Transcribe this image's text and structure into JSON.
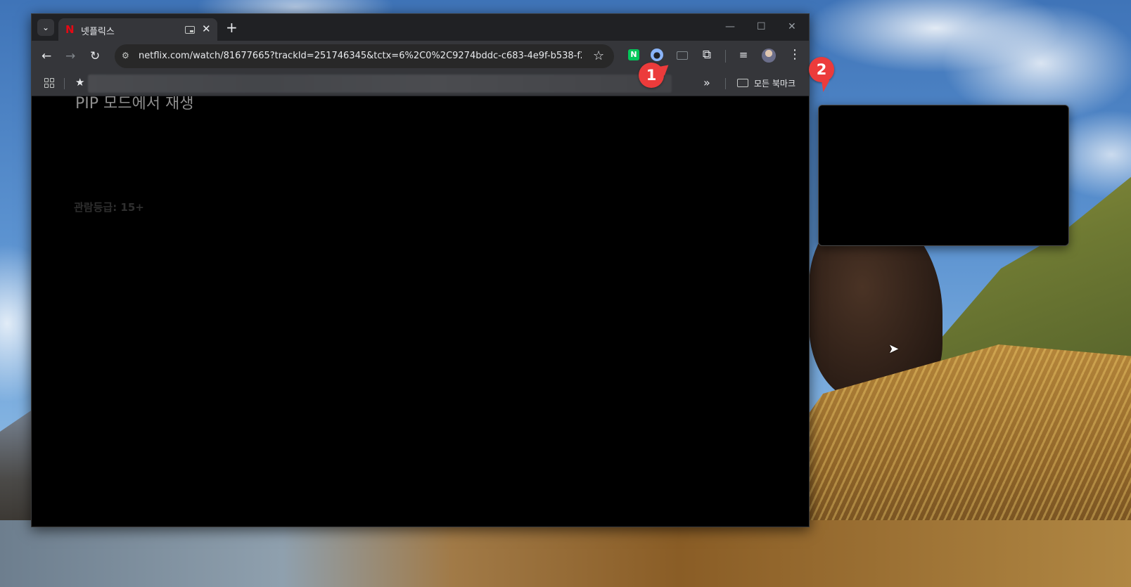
{
  "tab": {
    "title": "넷플릭스",
    "favicon": "netflix-icon"
  },
  "omnibox": {
    "url": "netflix.com/watch/81677665?trackId=251746345&tctx=6%2C0%2C9274bddc-c683-4e9f-b538-f28de..."
  },
  "extensions": {
    "naver_label": "N"
  },
  "bookmarks_bar": {
    "all_bookmarks_label": "모든 북마크"
  },
  "video": {
    "heading": "PIP 모드에서 재생",
    "rating": "관람등급: 15+"
  },
  "annotations": {
    "marker_1": "1",
    "marker_2": "2"
  },
  "colors": {
    "marker": "#ec3b3b",
    "netflix_red": "#e50914",
    "naver_green": "#03c75a"
  }
}
